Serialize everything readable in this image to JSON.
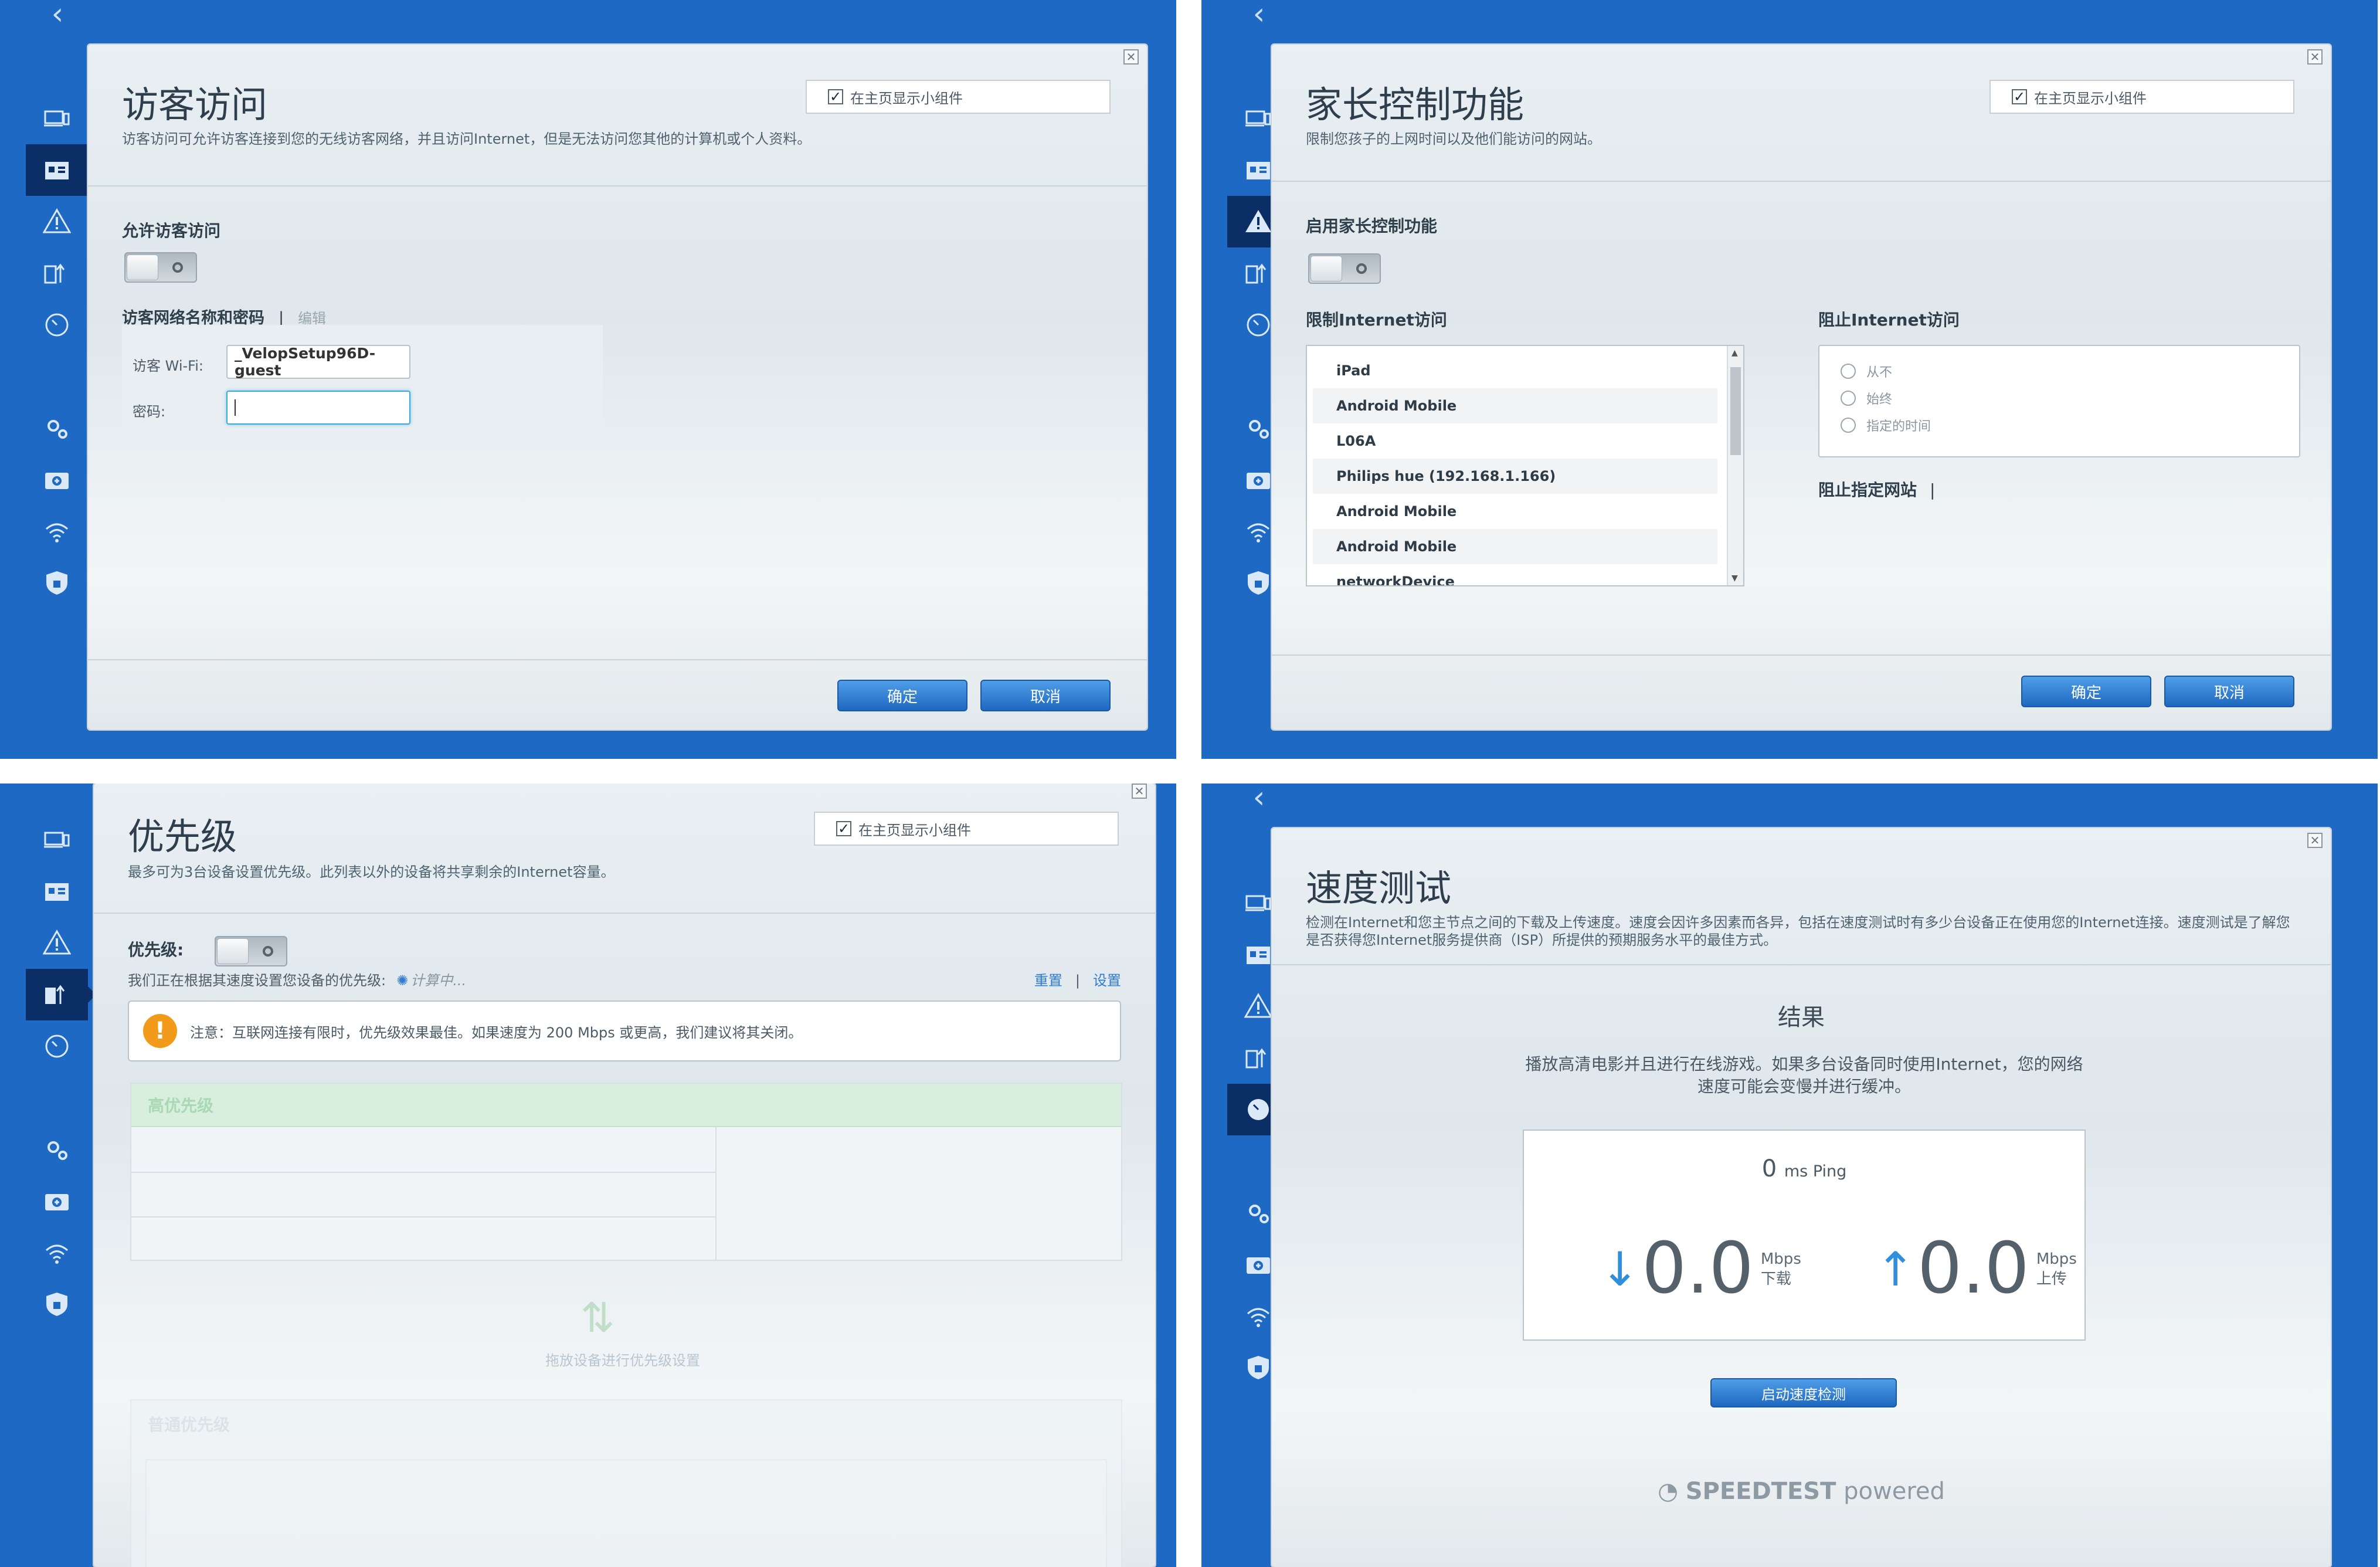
{
  "common": {
    "widget_label": "在主页显示小组件",
    "ok": "确定",
    "cancel": "取消"
  },
  "guest": {
    "title": "访客访问",
    "desc": "访客访问可允许访客连接到您的无线访客网络，并且访问Internet，但是无法访问您其他的计算机或个人资料。",
    "allow_label": "允许访客访问",
    "network_label": "访客网络名称和密码",
    "separator": "|",
    "edit": "编辑",
    "wifi_label": "访客 Wi-Fi:",
    "wifi_value": "_VelopSetup96D-guest",
    "password_label": "密码:",
    "password_value": ""
  },
  "parental": {
    "title": "家长控制功能",
    "desc": "限制您孩子的上网时间以及他们能访问的网站。",
    "enable_label": "启用家长控制功能",
    "restrict_label": "限制Internet访问",
    "devices": [
      "iPad",
      "Android Mobile",
      "L06A",
      "Philips hue (192.168.1.166)",
      "Android Mobile",
      "Android Mobile",
      "networkDevice"
    ],
    "block_label": "阻止Internet访问",
    "block_options": [
      "从不",
      "始终",
      "指定的时间"
    ],
    "block_sites_label": "阻止指定网站",
    "separator": "|"
  },
  "priority": {
    "title": "优先级",
    "desc": "最多可为3台设备设置优先级。此列表以外的设备将共享剩余的Internet容量。",
    "label": "优先级:",
    "status": "我们正在根据其速度设置您设备的优先级:",
    "calculating": "计算中...",
    "reset": "重置",
    "separator": "|",
    "settings": "设置",
    "notice": "注意：互联网连接有限时，优先级效果最佳。如果速度为 200 Mbps 或更高，我们建议将其关闭。",
    "high_priority": "高优先级",
    "drag_hint": "拖放设备进行优先级设置",
    "normal_priority": "普通优先级"
  },
  "speedtest": {
    "title": "速度测试",
    "desc": "检测在Internet和您主节点之间的下载及上传速度。速度会因许多因素而各异，包括在速度测试时有多少台设备正在使用您的Internet连接。速度测试是了解您是否获得您Internet服务提供商（ISP）所提供的预期服务水平的最佳方式。",
    "result_title": "结果",
    "result_desc": "播放高清电影并且进行在线游戏。如果多台设备同时使用Internet，您的网络速度可能会变慢并进行缓冲。",
    "ping_value": "0",
    "ping_unit": "ms Ping",
    "down_value": "0.0",
    "down_unit": "Mbps",
    "down_label": "下载",
    "up_value": "0.0",
    "up_unit": "Mbps",
    "up_label": "上传",
    "start_button": "启动速度检测",
    "brand": "SPEEDTEST",
    "brand_suffix": "powered"
  },
  "colors": {
    "background": "#1e69c4",
    "active_nav": "#0b2e66",
    "button": "#2f7bd0",
    "warning": "#f29a1a"
  },
  "icons": [
    "devices-icon",
    "guest-access-icon",
    "parental-controls-icon",
    "priority-icon",
    "speed-test-icon",
    "settings-icon",
    "backup-icon",
    "wifi-icon",
    "security-icon"
  ]
}
